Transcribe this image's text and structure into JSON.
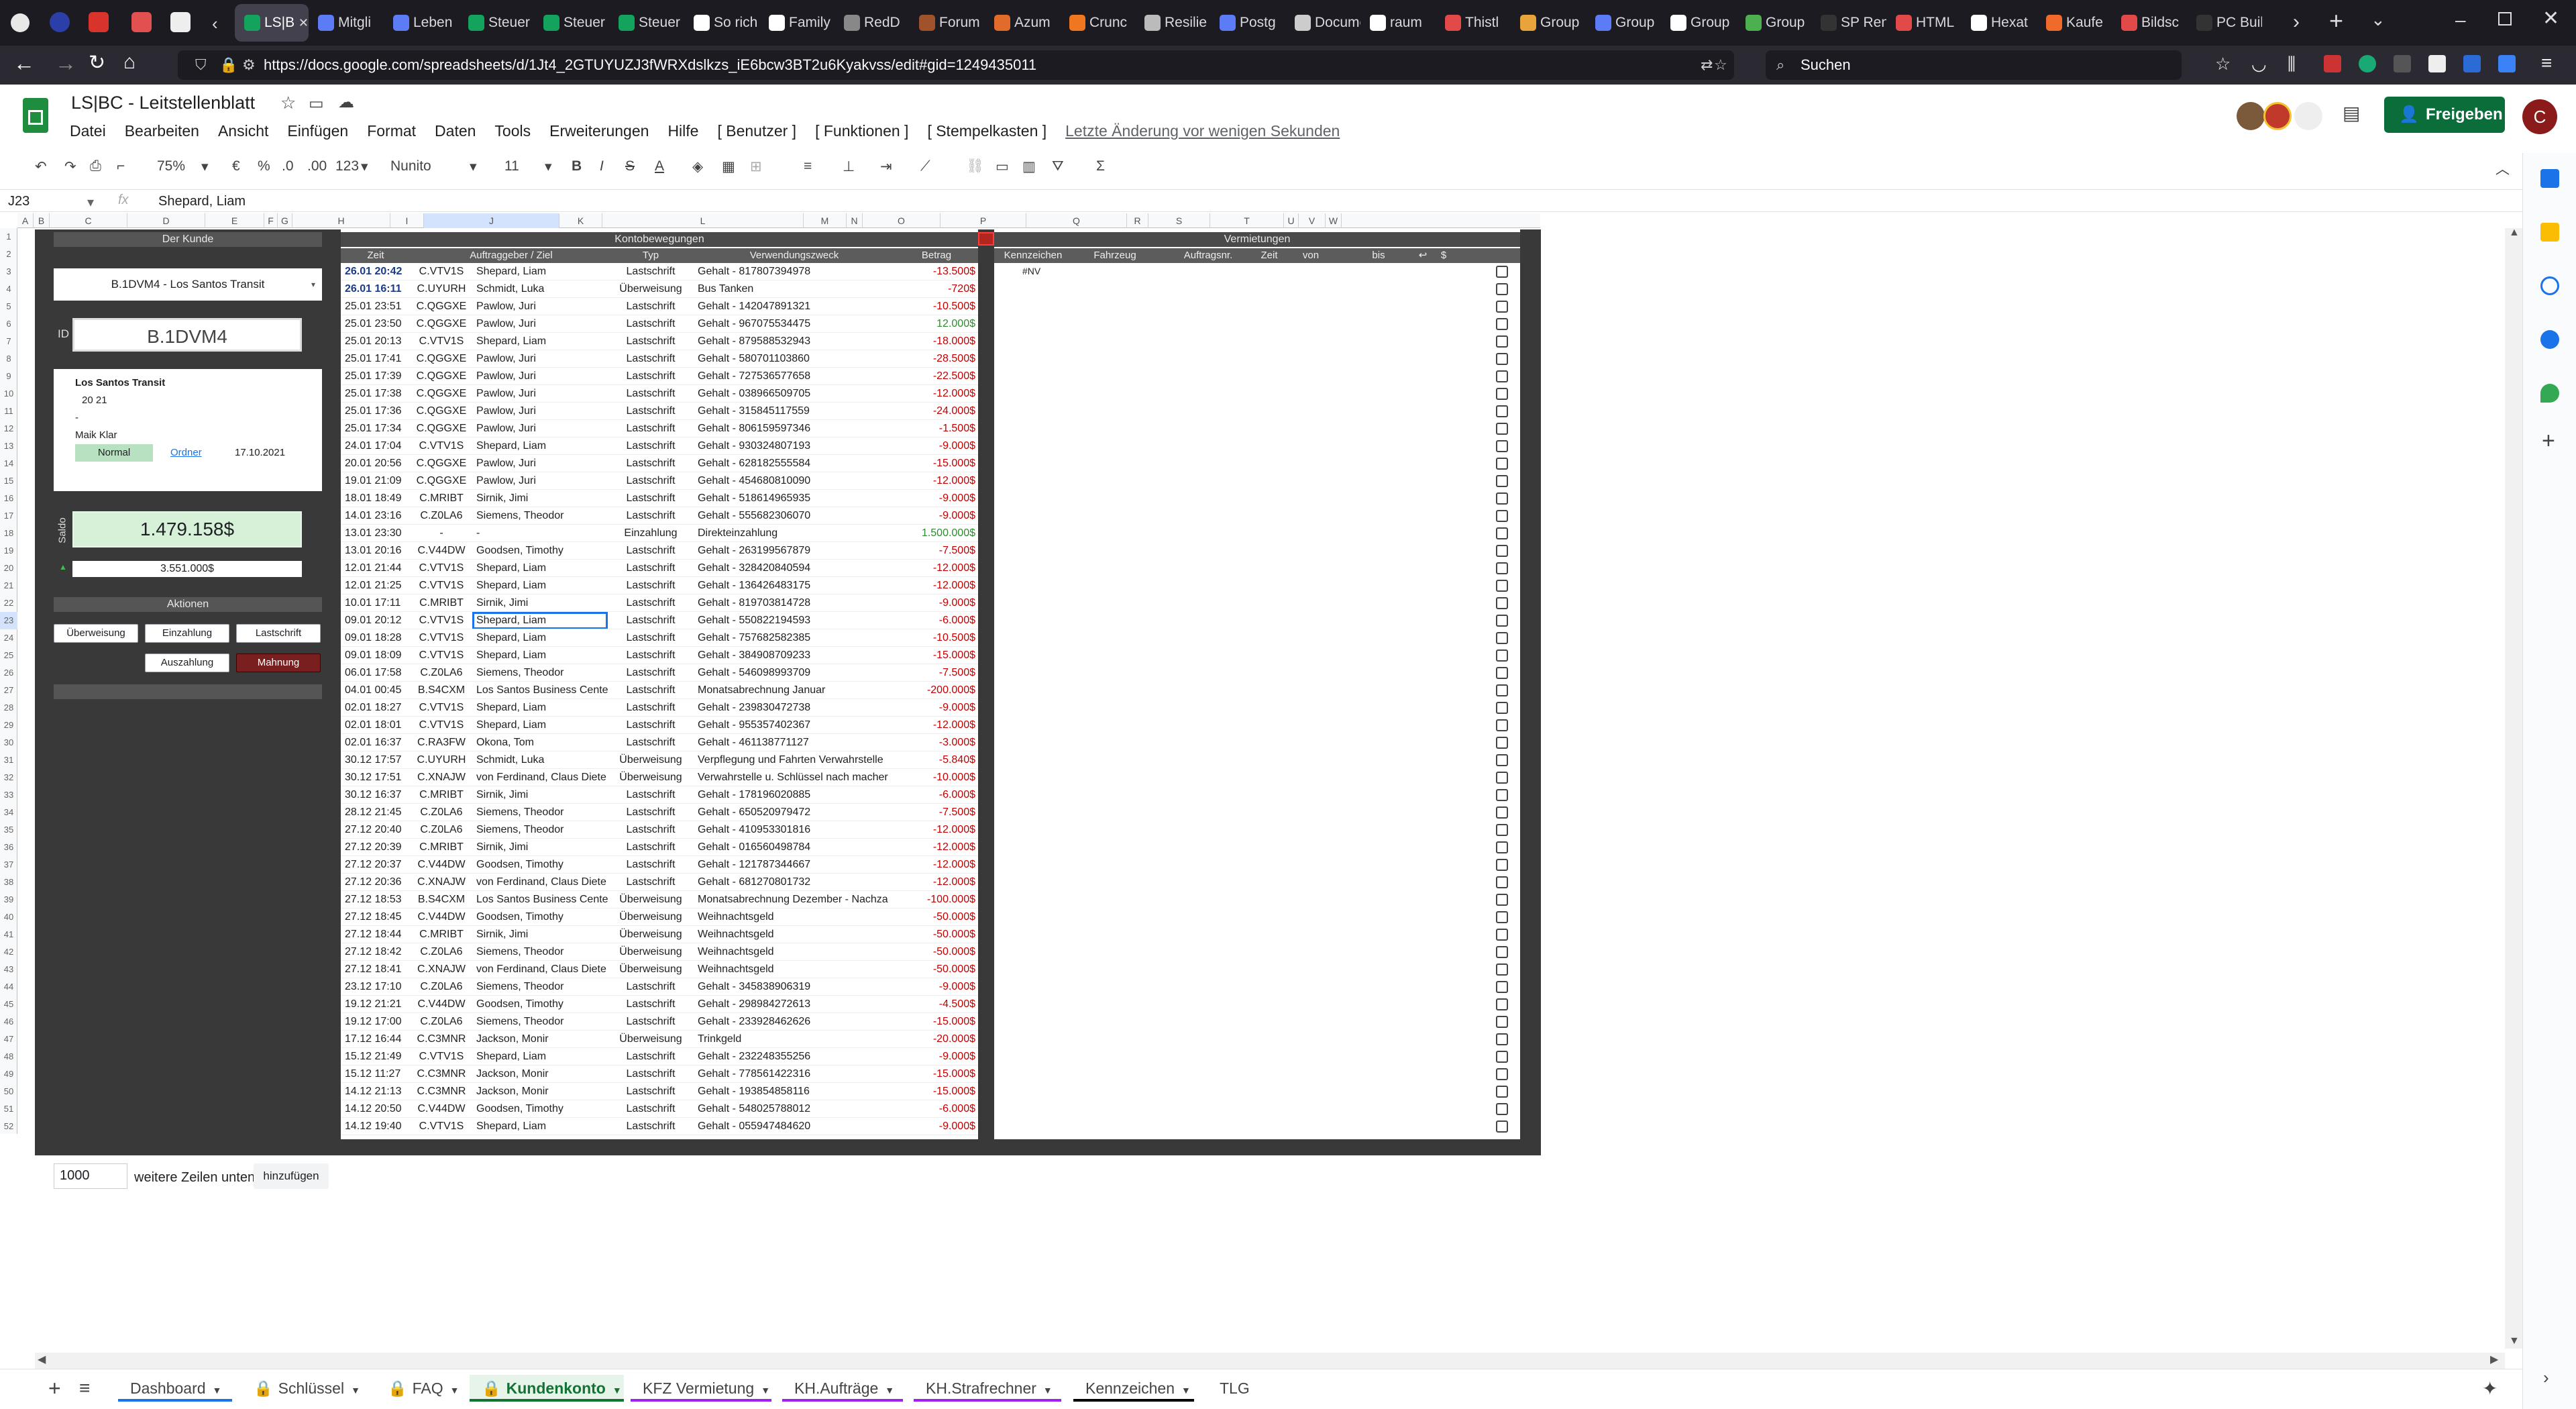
{
  "browser": {
    "tabs": [
      {
        "label": "LS|BC",
        "color": "#14a35d",
        "active": true
      },
      {
        "label": "Mitgli",
        "color": "#5b7cf5"
      },
      {
        "label": "Leben",
        "color": "#5b7cf5"
      },
      {
        "label": "Steuer",
        "color": "#14a35d"
      },
      {
        "label": "Steuer",
        "color": "#14a35d"
      },
      {
        "label": "Steuer",
        "color": "#14a35d"
      },
      {
        "label": "So rich",
        "color": "#ffffff"
      },
      {
        "label": "Family",
        "color": "#ffffff"
      },
      {
        "label": "RedD",
        "color": "#888888"
      },
      {
        "label": "Forum",
        "color": "#a0522d"
      },
      {
        "label": "Azum",
        "color": "#e06b2b"
      },
      {
        "label": "Crunc",
        "color": "#f0771f"
      },
      {
        "label": "Resilie",
        "color": "#bbbbbb"
      },
      {
        "label": "Postg",
        "color": "#5b7cf5"
      },
      {
        "label": "Documen",
        "color": "#cccccc"
      },
      {
        "label": "raum",
        "color": "#ffffff"
      },
      {
        "label": "Thistl",
        "color": "#e24a4a"
      },
      {
        "label": "Group",
        "color": "#e8a33a"
      },
      {
        "label": "Group",
        "color": "#5b7cf5"
      },
      {
        "label": "Group",
        "color": "#ffffff"
      },
      {
        "label": "Group",
        "color": "#4caf50"
      },
      {
        "label": "SP Rent",
        "color": "#333333"
      },
      {
        "label": "HTML",
        "color": "#e24a4a"
      },
      {
        "label": "Hexat",
        "color": "#ffffff"
      },
      {
        "label": "Kaufe",
        "color": "#f06a2b"
      },
      {
        "label": "Bildsc",
        "color": "#e24a4a"
      },
      {
        "label": "PC Buildin",
        "color": "#333333"
      }
    ],
    "url": "https://docs.google.com/spreadsheets/d/1Jt4_2GTUYUZJ3fWRXdslkzs_iE6bcw3BT2u6Kyakvss/edit#gid=1249435011",
    "search_placeholder": "Suchen"
  },
  "doc": {
    "title": "LS|BC - Leitstellenblatt",
    "menu": [
      "Datei",
      "Bearbeiten",
      "Ansicht",
      "Einfügen",
      "Format",
      "Daten",
      "Tools",
      "Erweiterungen",
      "Hilfe",
      "[ Benutzer ]",
      "[ Funktionen ]",
      "[ Stempelkasten ]"
    ],
    "last_change": "Letzte Änderung vor wenigen Sekunden",
    "share_label": "Freigeben",
    "avatar_letter": "C"
  },
  "toolbar": {
    "zoom": "75%",
    "currency": "€",
    "percent": "%",
    "dec_less": ".0",
    "dec_more": ".00",
    "format": "123",
    "font": "Nunito",
    "size": "11"
  },
  "formula": {
    "cell": "J23",
    "value": "Shepard, Liam"
  },
  "columns": [
    "A",
    "B",
    "C",
    "D",
    "E",
    "F",
    "G",
    "H",
    "I",
    "J",
    "K",
    "L",
    "M",
    "N",
    "O",
    "P",
    "Q",
    "R",
    "S",
    "T",
    "U",
    "V",
    "W"
  ],
  "customer": {
    "section_title": "Der Kunde",
    "dropdown": "B.1DVM4 - Los Santos Transit",
    "id_label": "ID",
    "id_value": "B.1DVM4",
    "name": "Los Santos Transit",
    "line2": "20 21",
    "line3": "-",
    "contact": "Maik Klar",
    "status": "Normal",
    "folder_link": "Ordner",
    "date": "17.10.2021",
    "saldo_label": "Saldo",
    "saldo": "1.479.158$",
    "limit": "3.551.000$",
    "actions_title": "Aktionen",
    "buttons": {
      "transfer": "Überweisung",
      "deposit": "Einzahlung",
      "debit": "Lastschrift",
      "payout": "Auszahlung",
      "reminder": "Mahnung"
    }
  },
  "konto": {
    "title": "Kontobewegungen",
    "headers": [
      "Zeit",
      "Auftraggeber / Ziel",
      "Typ",
      "Verwendungszweck",
      "Betrag"
    ],
    "rows": [
      [
        "26.01 20:42",
        "C.VTV1S",
        "Shepard, Liam",
        "Lastschrift",
        "Gehalt - 817807394978",
        "-13.500$"
      ],
      [
        "26.01 16:11",
        "C.UYURH",
        "Schmidt, Luka",
        "Überweisung",
        "Bus Tanken",
        "-720$"
      ],
      [
        "25.01 23:51",
        "C.QGGXE",
        "Pawlow, Juri",
        "Lastschrift",
        "Gehalt - 142047891321",
        "-10.500$"
      ],
      [
        "25.01 23:50",
        "C.QGGXE",
        "Pawlow, Juri",
        "Lastschrift",
        "Gehalt - 967075534475",
        "12.000$"
      ],
      [
        "25.01 20:13",
        "C.VTV1S",
        "Shepard, Liam",
        "Lastschrift",
        "Gehalt - 879588532943",
        "-18.000$"
      ],
      [
        "25.01 17:41",
        "C.QGGXE",
        "Pawlow, Juri",
        "Lastschrift",
        "Gehalt - 580701103860",
        "-28.500$"
      ],
      [
        "25.01 17:39",
        "C.QGGXE",
        "Pawlow, Juri",
        "Lastschrift",
        "Gehalt - 727536577658",
        "-22.500$"
      ],
      [
        "25.01 17:38",
        "C.QGGXE",
        "Pawlow, Juri",
        "Lastschrift",
        "Gehalt - 038966509705",
        "-12.000$"
      ],
      [
        "25.01 17:36",
        "C.QGGXE",
        "Pawlow, Juri",
        "Lastschrift",
        "Gehalt - 315845117559",
        "-24.000$"
      ],
      [
        "25.01 17:34",
        "C.QGGXE",
        "Pawlow, Juri",
        "Lastschrift",
        "Gehalt - 806159597346",
        "-1.500$"
      ],
      [
        "24.01 17:04",
        "C.VTV1S",
        "Shepard, Liam",
        "Lastschrift",
        "Gehalt - 930324807193",
        "-9.000$"
      ],
      [
        "20.01 20:56",
        "C.QGGXE",
        "Pawlow, Juri",
        "Lastschrift",
        "Gehalt - 628182555584",
        "-15.000$"
      ],
      [
        "19.01 21:09",
        "C.QGGXE",
        "Pawlow, Juri",
        "Lastschrift",
        "Gehalt - 454680810090",
        "-12.000$"
      ],
      [
        "18.01 18:49",
        "C.MRIBT",
        "Sirnik, Jimi",
        "Lastschrift",
        "Gehalt - 518614965935",
        "-9.000$"
      ],
      [
        "14.01 23:16",
        "C.Z0LA6",
        "Siemens, Theodor",
        "Lastschrift",
        "Gehalt - 555682306070",
        "-9.000$"
      ],
      [
        "13.01 23:30",
        "-",
        "-",
        "Einzahlung",
        "Direkteinzahlung",
        "1.500.000$"
      ],
      [
        "13.01 20:16",
        "C.V44DW",
        "Goodsen, Timothy",
        "Lastschrift",
        "Gehalt - 263199567879",
        "-7.500$"
      ],
      [
        "12.01 21:44",
        "C.VTV1S",
        "Shepard, Liam",
        "Lastschrift",
        "Gehalt - 328420840594",
        "-12.000$"
      ],
      [
        "12.01 21:25",
        "C.VTV1S",
        "Shepard, Liam",
        "Lastschrift",
        "Gehalt - 136426483175",
        "-12.000$"
      ],
      [
        "10.01 17:11",
        "C.MRIBT",
        "Sirnik, Jimi",
        "Lastschrift",
        "Gehalt - 819703814728",
        "-9.000$"
      ],
      [
        "09.01 20:12",
        "C.VTV1S",
        "Shepard, Liam",
        "Lastschrift",
        "Gehalt - 550822194593",
        "-6.000$"
      ],
      [
        "09.01 18:28",
        "C.VTV1S",
        "Shepard, Liam",
        "Lastschrift",
        "Gehalt - 757682582385",
        "-10.500$"
      ],
      [
        "09.01 18:09",
        "C.VTV1S",
        "Shepard, Liam",
        "Lastschrift",
        "Gehalt - 384908709233",
        "-15.000$"
      ],
      [
        "06.01 17:58",
        "C.Z0LA6",
        "Siemens, Theodor",
        "Lastschrift",
        "Gehalt - 546098993709",
        "-7.500$"
      ],
      [
        "04.01 00:45",
        "B.S4CXM",
        "Los Santos Business Cente",
        "Lastschrift",
        "Monatsabrechnung Januar",
        "-200.000$"
      ],
      [
        "02.01 18:27",
        "C.VTV1S",
        "Shepard, Liam",
        "Lastschrift",
        "Gehalt - 239830472738",
        "-9.000$"
      ],
      [
        "02.01 18:01",
        "C.VTV1S",
        "Shepard, Liam",
        "Lastschrift",
        "Gehalt - 955357402367",
        "-12.000$"
      ],
      [
        "02.01 16:37",
        "C.RA3FW",
        "Okona, Tom",
        "Lastschrift",
        "Gehalt - 461138771127",
        "-3.000$"
      ],
      [
        "30.12 17:57",
        "C.UYURH",
        "Schmidt, Luka",
        "Überweisung",
        "Verpflegung und Fahrten Verwahrstelle",
        "-5.840$"
      ],
      [
        "30.12 17:51",
        "C.XNAJW",
        "von Ferdinand, Claus Diete",
        "Überweisung",
        "Verwahrstelle u. Schlüssel nach macher",
        "-10.000$"
      ],
      [
        "30.12 16:37",
        "C.MRIBT",
        "Sirnik, Jimi",
        "Lastschrift",
        "Gehalt - 178196020885",
        "-6.000$"
      ],
      [
        "28.12 21:45",
        "C.Z0LA6",
        "Siemens, Theodor",
        "Lastschrift",
        "Gehalt - 650520979472",
        "-7.500$"
      ],
      [
        "27.12 20:40",
        "C.Z0LA6",
        "Siemens, Theodor",
        "Lastschrift",
        "Gehalt - 410953301816",
        "-12.000$"
      ],
      [
        "27.12 20:39",
        "C.MRIBT",
        "Sirnik, Jimi",
        "Lastschrift",
        "Gehalt - 016560498784",
        "-12.000$"
      ],
      [
        "27.12 20:37",
        "C.V44DW",
        "Goodsen, Timothy",
        "Lastschrift",
        "Gehalt - 121787344667",
        "-12.000$"
      ],
      [
        "27.12 20:36",
        "C.XNAJW",
        "von Ferdinand, Claus Diete",
        "Lastschrift",
        "Gehalt - 681270801732",
        "-12.000$"
      ],
      [
        "27.12 18:53",
        "B.S4CXM",
        "Los Santos Business Cente",
        "Überweisung",
        "Monatsabrechnung Dezember - Nachza",
        "-100.000$"
      ],
      [
        "27.12 18:45",
        "C.V44DW",
        "Goodsen, Timothy",
        "Überweisung",
        "Weihnachtsgeld",
        "-50.000$"
      ],
      [
        "27.12 18:44",
        "C.MRIBT",
        "Sirnik, Jimi",
        "Überweisung",
        "Weihnachtsgeld",
        "-50.000$"
      ],
      [
        "27.12 18:42",
        "C.Z0LA6",
        "Siemens, Theodor",
        "Überweisung",
        "Weihnachtsgeld",
        "-50.000$"
      ],
      [
        "27.12 18:41",
        "C.XNAJW",
        "von Ferdinand, Claus Diete",
        "Überweisung",
        "Weihnachtsgeld",
        "-50.000$"
      ],
      [
        "23.12 17:10",
        "C.Z0LA6",
        "Siemens, Theodor",
        "Lastschrift",
        "Gehalt - 345838906319",
        "-9.000$"
      ],
      [
        "19.12 21:21",
        "C.V44DW",
        "Goodsen, Timothy",
        "Lastschrift",
        "Gehalt - 298984272613",
        "-4.500$"
      ],
      [
        "19.12 17:00",
        "C.Z0LA6",
        "Siemens, Theodor",
        "Lastschrift",
        "Gehalt - 233928462626",
        "-15.000$"
      ],
      [
        "17.12 16:44",
        "C.C3MNR",
        "Jackson, Monir",
        "Überweisung",
        "Trinkgeld",
        "-20.000$"
      ],
      [
        "15.12 21:49",
        "C.VTV1S",
        "Shepard, Liam",
        "Lastschrift",
        "Gehalt - 232248355256",
        "-9.000$"
      ],
      [
        "15.12 11:27",
        "C.C3MNR",
        "Jackson, Monir",
        "Lastschrift",
        "Gehalt - 778561422316",
        "-15.000$"
      ],
      [
        "14.12 21:13",
        "C.C3MNR",
        "Jackson, Monir",
        "Lastschrift",
        "Gehalt - 193854858116",
        "-15.000$"
      ],
      [
        "14.12 20:50",
        "C.V44DW",
        "Goodsen, Timothy",
        "Lastschrift",
        "Gehalt - 548025788012",
        "-6.000$"
      ],
      [
        "14.12 19:40",
        "C.VTV1S",
        "Shepard, Liam",
        "Lastschrift",
        "Gehalt - 055947484620",
        "-9.000$"
      ]
    ]
  },
  "vermietungen": {
    "title": "Vermietungen",
    "headers": [
      "Kennzeichen",
      "Fahrzeug",
      "Auftragsnr.",
      "Zeit",
      "von",
      "bis",
      "↩",
      "$"
    ],
    "first_row": "#NV"
  },
  "footer": {
    "rows_value": "1000",
    "rows_label": "weitere Zeilen unten",
    "add_button": "hinzufügen"
  },
  "sheet_tabs": [
    {
      "label": "Dashboard",
      "active": false,
      "lock": false,
      "color": "#1a73e8"
    },
    {
      "label": "Schlüssel",
      "active": false,
      "lock": true,
      "color": ""
    },
    {
      "label": "FAQ",
      "active": false,
      "lock": true,
      "color": ""
    },
    {
      "label": "Kundenkonto",
      "active": true,
      "lock": true,
      "color": "#a020f0"
    },
    {
      "label": "KFZ Vermietung",
      "active": false,
      "lock": false,
      "color": "#a020f0"
    },
    {
      "label": "KH.Aufträge",
      "active": false,
      "lock": false,
      "color": "#a020f0"
    },
    {
      "label": "KH.Strafrechner",
      "active": false,
      "lock": false,
      "color": "#a020f0"
    },
    {
      "label": "Kennzeichen",
      "active": false,
      "lock": false,
      "color": "#000000"
    },
    {
      "label": "TLG KFZ",
      "active": false,
      "lock": false,
      "color": ""
    }
  ]
}
